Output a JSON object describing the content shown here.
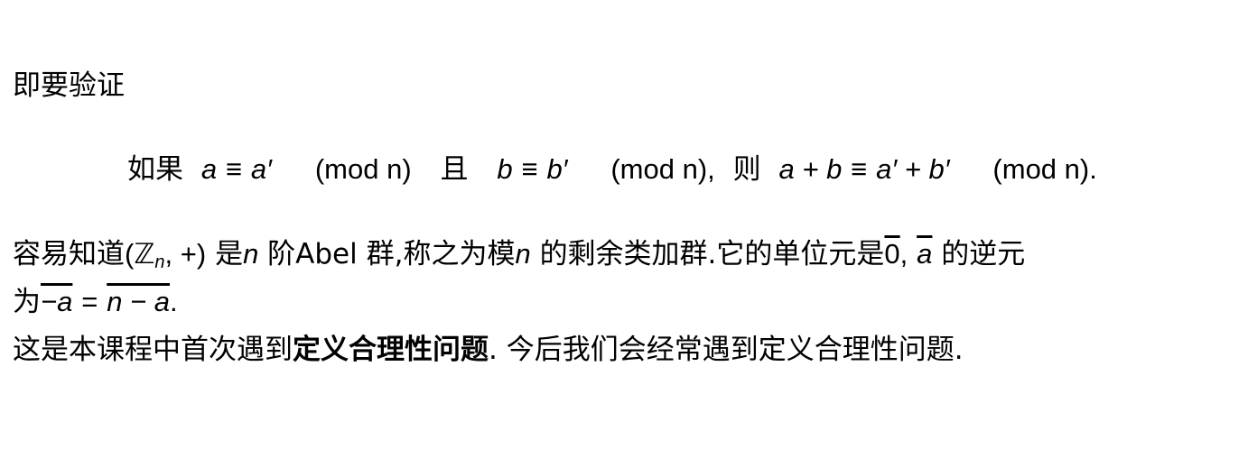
{
  "line1": "即要验证",
  "line2": {
    "ru_guo": "如果",
    "a": "a",
    "eq": "≡",
    "a_prime": "a′",
    "mod1": "(mod n)",
    "qie": "且",
    "b": "b",
    "b_prime": "b′",
    "mod2": "(mod n),",
    "ze": "则",
    "sum_left": "a + b",
    "sum_right": "a′ + b′",
    "mod3": "(mod n)."
  },
  "line3": {
    "text1": "容易知道",
    "group_open": "(ℤ",
    "group_sub": "n",
    "group_rest": ", +)",
    "text2": "是",
    "n1": "n",
    "text3": "阶Abel 群,称之为模",
    "n2": "n",
    "text4": "的剩余类加群.它的单位元是",
    "zero_bar": "0",
    "comma": ",",
    "a_bar": "a",
    "text5": "的逆元"
  },
  "line4": {
    "text1": "为",
    "neg_a": "−a",
    "eq": "=",
    "n_minus_a": "n − a",
    "period": "."
  },
  "line5": {
    "text1": "这是本课程中首次遇到",
    "bold": "定义合理性问题",
    "text2": ". 今后我们会经常遇到定义合理性问题."
  }
}
